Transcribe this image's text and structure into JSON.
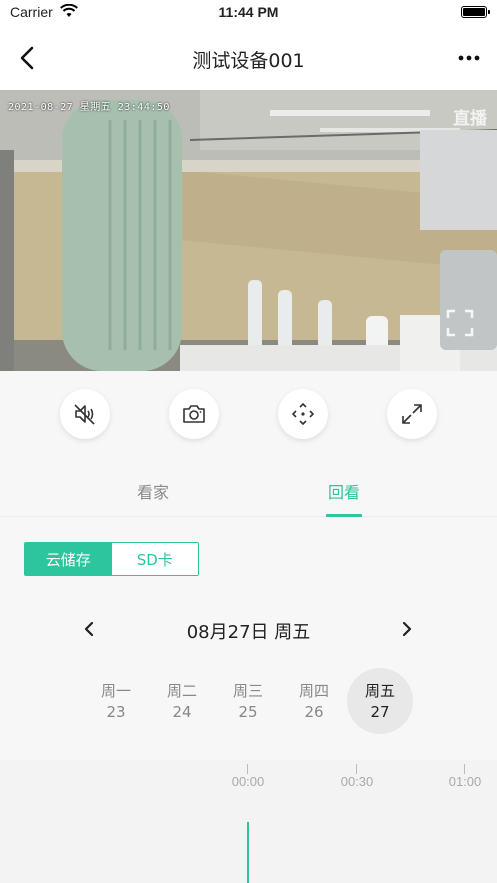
{
  "status_bar": {
    "carrier": "Carrier",
    "time": "11:44 PM"
  },
  "nav": {
    "title": "测试设备001",
    "back_icon": "chevron-left-icon",
    "more_icon": "more-horizontal-icon"
  },
  "video": {
    "osd_time": "2021-08-27 星期五 23:44:50",
    "live_label": "直播"
  },
  "controls": [
    {
      "name": "mute-button",
      "icon": "speaker-muted-icon"
    },
    {
      "name": "snapshot-button",
      "icon": "camera-icon"
    },
    {
      "name": "ptz-button",
      "icon": "direction-pad-icon"
    },
    {
      "name": "fullscreen-button",
      "icon": "expand-icon"
    }
  ],
  "tabs": [
    {
      "label": "看家",
      "active": false
    },
    {
      "label": "回看",
      "active": true
    }
  ],
  "storage": {
    "cloud_label": "云储存",
    "sd_label": "SD卡",
    "selected": "cloud"
  },
  "date_nav": {
    "current_date": "08月27日 周五"
  },
  "week": [
    {
      "name": "周一",
      "num": "23"
    },
    {
      "name": "周二",
      "num": "24"
    },
    {
      "name": "周三",
      "num": "25"
    },
    {
      "name": "周四",
      "num": "26"
    },
    {
      "name": "周五",
      "num": "27",
      "selected": true
    }
  ],
  "timeline": {
    "labels": [
      "00:00",
      "00:30",
      "01:00"
    ]
  },
  "colors": {
    "accent": "#2dc59d",
    "text_dark": "#222222",
    "text_muted": "#888888",
    "background": "#f7f7f7"
  }
}
